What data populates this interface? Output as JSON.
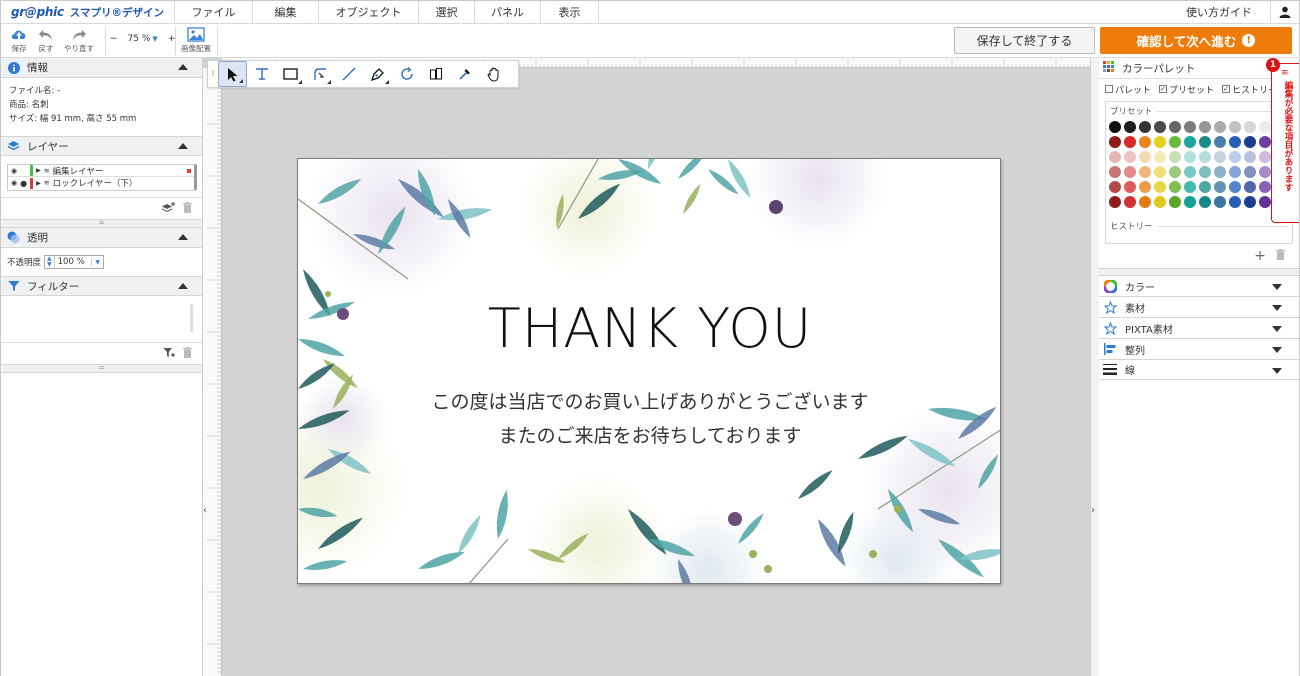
{
  "brand": {
    "logo": "gr@phic",
    "app_name": "スマプリ®デザイン"
  },
  "menu": [
    "ファイル",
    "編集",
    "オブジェクト",
    "選択",
    "パネル",
    "表示"
  ],
  "guide_label": "使い方ガイド",
  "toolbar": {
    "save": "保存",
    "undo": "戻す",
    "redo": "やり直す",
    "zoom_minus": "−",
    "zoom_value": "75 %",
    "zoom_plus": "+",
    "image_place": "画像配置",
    "save_exit": "保存して終了する",
    "confirm": "確認して次へ進む"
  },
  "left_panel": {
    "info": {
      "title": "情報",
      "filename": "ファイル名:  -",
      "product": "商品:  名刺",
      "size": "サイズ:  幅 91 mm,  高さ 55 mm"
    },
    "layers": {
      "title": "レイヤー",
      "items": [
        {
          "label": "編集レイヤー",
          "color": "#3fbf3f"
        },
        {
          "label": "ロックレイヤー（下）",
          "color": "#e03a3a"
        }
      ]
    },
    "transparency": {
      "title": "透明",
      "label": "不透明度",
      "value": "100 %"
    },
    "filter": {
      "title": "フィルター"
    }
  },
  "card": {
    "title": "THANK YOU",
    "line1": "この度は当店でのお買い上げありがとうございます",
    "line2": "またのご来店をお待ちしております"
  },
  "right_panel": {
    "palette": {
      "title": "カラーパレット",
      "options": [
        "パレット",
        "プリセット",
        "ヒストリー"
      ],
      "preset_label": "プリセット",
      "history_label": "ヒストリー",
      "swatches": [
        "#111111",
        "#1e1e1e",
        "#333333",
        "#4a4a4a",
        "#666666",
        "#7d7d7d",
        "#959595",
        "#ababab",
        "#c2c2c2",
        "#d8d8d8",
        "#ececec",
        "#8e1b1b",
        "#d62b2b",
        "#e8861c",
        "#e5d020",
        "#69b93a",
        "#19a6a0",
        "#1b8c8c",
        "#4a7fa8",
        "#2760b8",
        "#1c3e8f",
        "#6a3e9f",
        "#e6b6b6",
        "#f0c2c2",
        "#f5d9b5",
        "#f3ecb5",
        "#c6dfb3",
        "#b3e0dc",
        "#b6dbd9",
        "#c3d4e0",
        "#bccbe8",
        "#b9c1dc",
        "#cfbbdf",
        "#c97575",
        "#e48a8a",
        "#efb77a",
        "#ebe07a",
        "#9bcc79",
        "#75cbc4",
        "#7abfbd",
        "#8eb1c9",
        "#86a4d8",
        "#8391c2",
        "#a98bc8",
        "#b24848",
        "#df5c5c",
        "#ec9d48",
        "#e7d64a",
        "#7fbe52",
        "#46b9b1",
        "#4ba6a4",
        "#6595b6",
        "#5683c9",
        "#5367aa",
        "#8a62b5",
        "#8f1d1d",
        "#d13131",
        "#e17d13",
        "#e0c81d",
        "#5aa62a",
        "#16a098",
        "#19868a",
        "#3d739d",
        "#2a5cb5",
        "#1f3f8e",
        "#5e3596"
      ]
    },
    "accordions": [
      "カラー",
      "素材",
      "PIXTA素材",
      "整列",
      "線"
    ]
  },
  "alert": {
    "count": "1",
    "text": "編集が必要な項目があります"
  }
}
